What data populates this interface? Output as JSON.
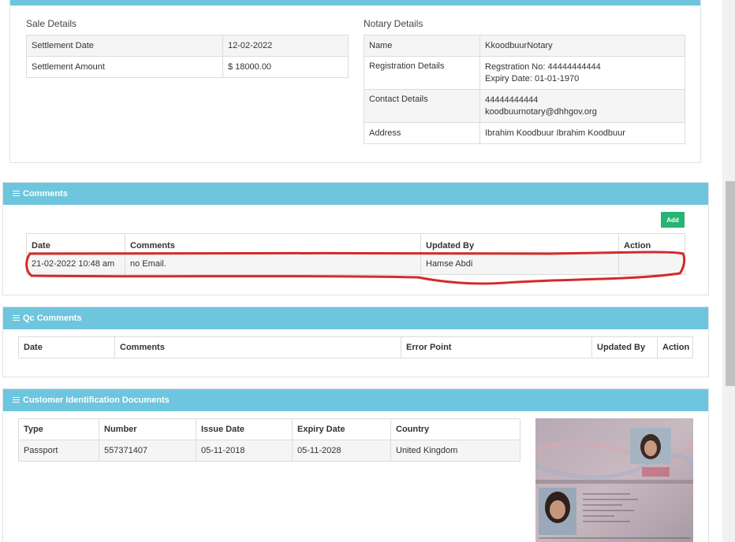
{
  "sale": {
    "title": "Sale Details",
    "rows": [
      {
        "label": "Settlement Date",
        "value": "12-02-2022"
      },
      {
        "label": "Settlement Amount",
        "value": "$ 18000.00"
      }
    ]
  },
  "notary": {
    "title": "Notary Details",
    "name_label": "Name",
    "name_value": "KkoodbuurNotary",
    "reg_label": "Registration Details",
    "reg_line1": "Regstration No: 44444444444",
    "reg_line2": "Expiry Date: 01-01-1970",
    "contact_label": "Contact Details",
    "contact_line1": "44444444444",
    "contact_line2": "koodbuurnotary@dhhgov.org",
    "address_label": "Address",
    "address_value": "Ibrahim Koodbuur Ibrahim Koodbuur"
  },
  "comments": {
    "title": "Comments",
    "add_label": "Add",
    "headers": [
      "Date",
      "Comments",
      "Updated By",
      "Action"
    ],
    "row": {
      "date": "21-02-2022 10:48 am",
      "comment": "no Email.",
      "updated_by": "Hamse Abdi",
      "action": ""
    },
    "highlight_color": "#d42a2a"
  },
  "qc": {
    "title": "Qc Comments",
    "headers": [
      "Date",
      "Comments",
      "Error Point",
      "Updated By",
      "Action"
    ]
  },
  "docs": {
    "title": "Customer Identification Documents",
    "headers": [
      "Type",
      "Number",
      "Issue Date",
      "Expiry Date",
      "Country"
    ],
    "row": {
      "type": "Passport",
      "number": "557371407",
      "issue": "05-11-2018",
      "expiry": "05-11-2028",
      "country": "United Kingdom"
    }
  },
  "colors": {
    "header": "#6ec5de",
    "add_button": "#25b574"
  }
}
